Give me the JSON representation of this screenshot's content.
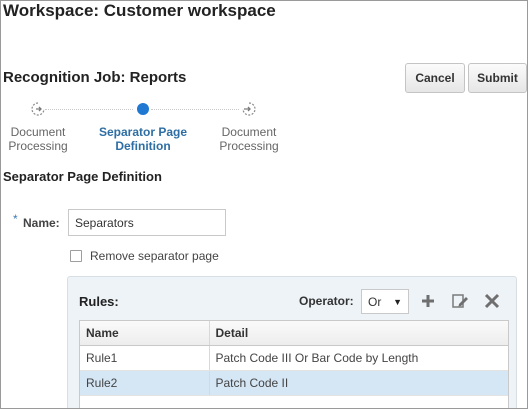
{
  "workspace": {
    "title": "Workspace: Customer workspace"
  },
  "job": {
    "title": "Recognition Job: Reports"
  },
  "actions": {
    "cancel_label": "Cancel",
    "submit_label": "Submit"
  },
  "train": {
    "steps": [
      {
        "label_line1": "Document",
        "label_line2": "Processing",
        "state": "previous",
        "icon": "arrow-right-circle-icon"
      },
      {
        "label_line1": "Separator Page",
        "label_line2": "Definition",
        "state": "current",
        "icon": "current-step-dot-icon"
      },
      {
        "label_line1": "Document",
        "label_line2": "Processing",
        "state": "next",
        "icon": "arrow-left-circle-icon"
      }
    ]
  },
  "section": {
    "title": "Separator Page Definition"
  },
  "name_field": {
    "required_marker": "*",
    "label": "Name:",
    "value": "Separators"
  },
  "remove_separator": {
    "label": "Remove separator page",
    "checked": false
  },
  "rules": {
    "title": "Rules:",
    "operator_label": "Operator:",
    "operator_value": "Or",
    "columns": [
      "Name",
      "Detail"
    ],
    "rows": [
      {
        "name": "Rule1",
        "detail": "Patch Code III Or Bar Code by Length",
        "selected": false
      },
      {
        "name": "Rule2",
        "detail": "Patch Code II",
        "selected": true
      }
    ]
  },
  "colors": {
    "accent": "#2e6ea4",
    "selected_row": "#d5e6f5",
    "panel": "#eef3f7"
  }
}
